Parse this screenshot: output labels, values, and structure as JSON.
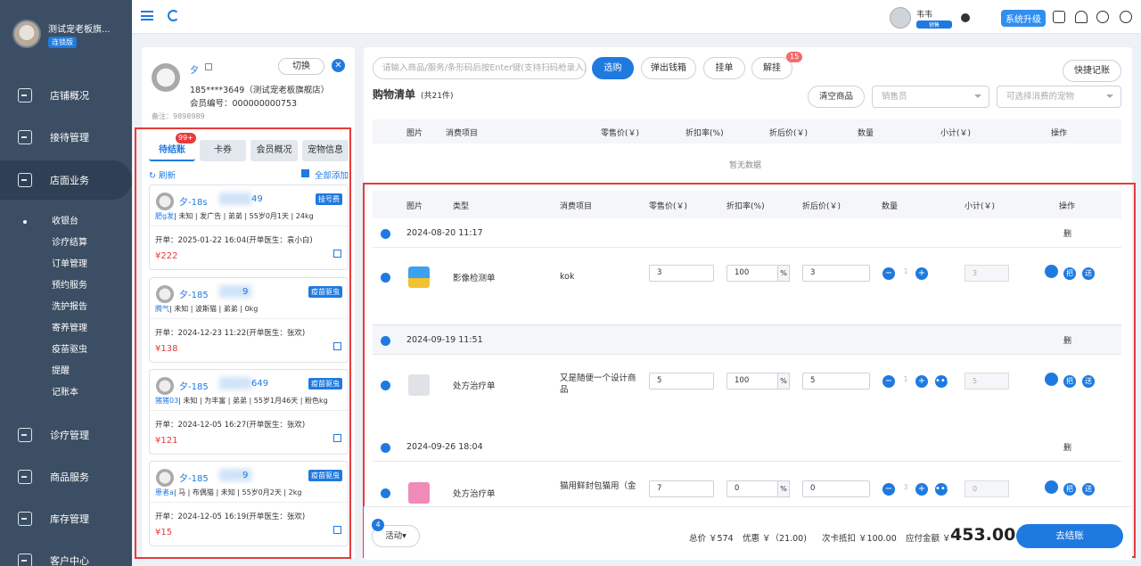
{
  "sidebar": {
    "shop_name": "测试宠老板旗...",
    "shop_badge": "连锁版",
    "nav": [
      {
        "label": "店铺概况"
      },
      {
        "label": "接待管理"
      },
      {
        "label": "店面业务"
      },
      {
        "label": "诊疗管理"
      },
      {
        "label": "商品服务"
      },
      {
        "label": "库存管理"
      },
      {
        "label": "客户中心"
      }
    ],
    "sub_items": [
      "收银台",
      "诊疗结算",
      "订单管理",
      "预约服务",
      "洗护报告",
      "寄养管理",
      "疫苗驱虫",
      "提醒",
      "记账本"
    ]
  },
  "topbar": {
    "user_name": "韦韦",
    "user_role": "销售",
    "upgrade": "系统升级"
  },
  "customer": {
    "name": "夕",
    "switch": "切换",
    "close": "✕",
    "phone": "185****3649（测试宠老板旗舰店）",
    "member_no": "会员编号：000000000753",
    "note": "备注：9898989"
  },
  "tabs": {
    "pending": "待结账",
    "pending_badge": "99+",
    "card": "卡券",
    "member": "会员概况",
    "pet": "宠物信息"
  },
  "links": {
    "refresh": "刷新",
    "add_all": "全部添加"
  },
  "cards": [
    {
      "name": "夕-18s",
      "suffix": "49",
      "tag": "挂号费",
      "pet": "肥g发",
      "info": "| 未知 | 发广告 | 弟弟 | 55岁0月1天 | 24kg",
      "open": "开单：2025-01-22 16:04(开单医生：袁小白)",
      "amount": "¥222"
    },
    {
      "name": "夕-185",
      "suffix": "9",
      "tag": "疫苗驱虫",
      "pet": "腾气",
      "info": "| 未知 | 波斯猫 | 弟弟 | 0kg",
      "open": "开单：2024-12-23 11:22(开单医生：张欢)",
      "amount": "¥138"
    },
    {
      "name": "夕-185",
      "suffix": "649",
      "tag": "疫苗驱虫",
      "pet": "猪猪03",
      "info": "| 未知 | 为丰富 | 弟弟 | 55岁1月46天 | 粉色kg",
      "open": "开单：2024-12-05 16:27(开单医生：张欢)",
      "amount": "¥121"
    },
    {
      "name": "夕-185",
      "suffix": "9",
      "tag": "疫苗驱虫",
      "pet": "患者a",
      "info": "| 马 | 布偶猫 | 未知 | 55岁0月2天 | 2kg",
      "open": "开单：2024-12-05 16:19(开单医生：张欢)",
      "amount": "¥15"
    }
  ],
  "toolbar": {
    "search_placeholder": "请输入商品/服务/条形码后按Enter键(支持扫码枪录入)",
    "select": "选购",
    "drawer": "弹出钱箱",
    "hang": "挂单",
    "unhang": "解挂",
    "unhang_badge": "15",
    "quick": "快捷记账"
  },
  "list": {
    "title": "购物清单",
    "count": "(共21件)",
    "clear": "清空商品",
    "seller_placeholder": "销售员",
    "pet_placeholder": "可选择消费的宠物"
  },
  "head1": [
    "图片",
    "消费项目",
    "零售价(￥)",
    "折扣率(%)",
    "折后价(￥)",
    "数量",
    "小计(￥)",
    "操作"
  ],
  "empty": "暂无数据",
  "head2": [
    "图片",
    "类型",
    "消费项目",
    "零售价(￥)",
    "折扣率(%)",
    "折后价(￥)",
    "数量",
    "小计(￥)",
    "操作"
  ],
  "groups": [
    {
      "time": "2024-08-20 11:17",
      "del": "删",
      "type": "影像检测单",
      "item": "kok",
      "price": "3",
      "rate": "100",
      "after": "3",
      "qty": "1",
      "subtotal": "3"
    },
    {
      "time": "2024-09-19 11:51",
      "del": "删",
      "type": "处方治疗单",
      "item": "又是随便一个设计商品",
      "price": "5",
      "rate": "100",
      "after": "5",
      "qty": "1",
      "subtotal": "5"
    },
    {
      "time": "2024-09-26 18:04",
      "del": "删",
      "type": "处方治疗单",
      "item": "猫用鲜封包猫用（金",
      "price": "7",
      "rate": "0",
      "after": "0",
      "qty": "3",
      "subtotal": "0"
    }
  ],
  "ops": {
    "pct": "%",
    "hold": "把",
    "give": "送"
  },
  "footer": {
    "activity": "活动▾",
    "activity_badge": "4",
    "total": "总价 ￥574",
    "discount": "优惠 ￥（21.00)",
    "card_deduct": "次卡抵扣 ￥100.00",
    "pay_label": "应付金额 ￥",
    "pay_amount": "453.00",
    "checkout": "去结账"
  }
}
